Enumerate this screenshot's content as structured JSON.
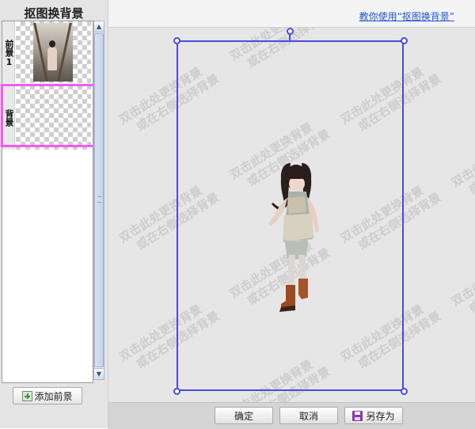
{
  "left_panel": {
    "title": "抠图换背景",
    "layers": [
      {
        "tab_label": "前景1",
        "kind": "foreground"
      },
      {
        "tab_label": "背景",
        "kind": "background",
        "selected": true
      }
    ],
    "add_foreground_label": "添加前景"
  },
  "top_bar": {
    "help_link": "教你使用“抠图换背景”"
  },
  "canvas": {
    "watermark_line1": "双击此处更换背景",
    "watermark_line2": "或在右侧选择背景"
  },
  "bottom_bar": {
    "confirm_label": "确定",
    "cancel_label": "取消",
    "save_as_label": "另存为"
  },
  "colors": {
    "selection_frame": "#f25cf0",
    "bounding_box": "#4a4ae0",
    "link": "#2255cc"
  }
}
